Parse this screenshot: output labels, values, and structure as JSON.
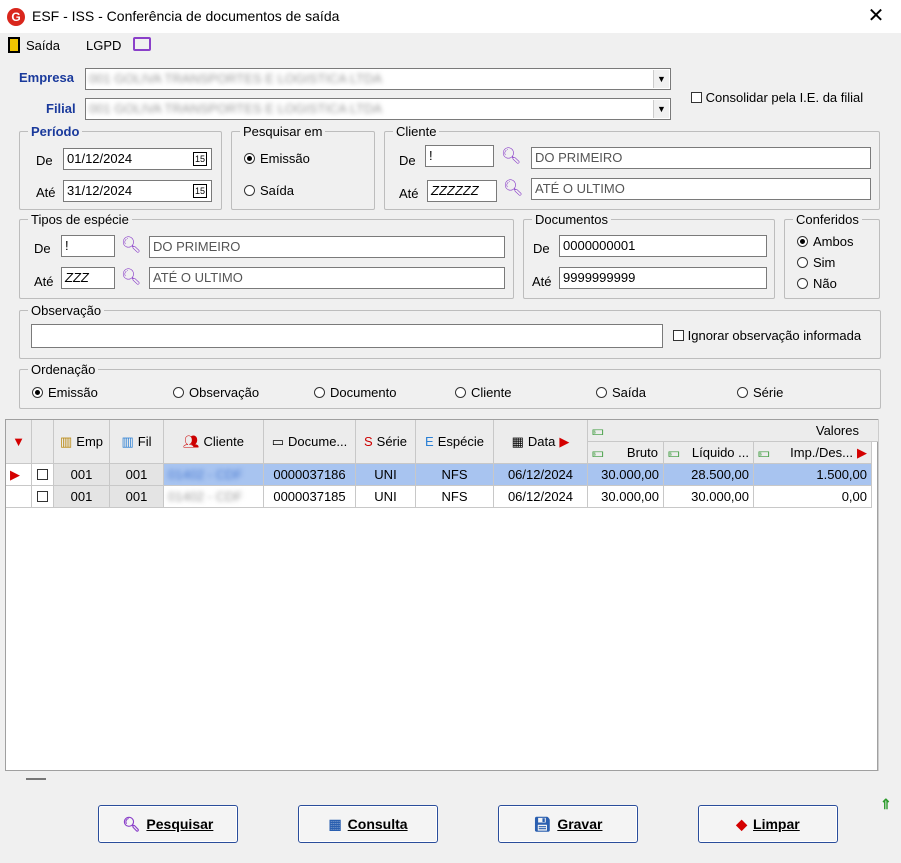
{
  "window": {
    "title": "ESF - ISS - Conferência de documentos de saída",
    "close_glyph": "✕",
    "logo_glyph": "G"
  },
  "menu": {
    "exit_label": "Saída",
    "lgpd_label": "LGPD"
  },
  "empresa": {
    "label": "Empresa",
    "value": "001 GOLIVA TRANSPORTES E LOGISTICA LTDA"
  },
  "filial": {
    "label": "Filial",
    "value": "001 GOLIVA TRANSPORTES E LOGISTICA LTDA"
  },
  "consolidar_label": "Consolidar pela I.E. da filial",
  "periodo": {
    "legend": "Período",
    "de_label": "De",
    "de_value": "01/12/2024",
    "ate_label": "Até",
    "ate_value": "31/12/2024"
  },
  "pesquisar": {
    "legend": "Pesquisar em",
    "opt1": "Emissão",
    "opt2": "Saída"
  },
  "cliente": {
    "legend": "Cliente",
    "de_label": "De",
    "de_code": "!",
    "de_name": "DO PRIMEIRO",
    "ate_label": "Até",
    "ate_code": "ZZZZZZ",
    "ate_name": "ATÉ O ULTIMO"
  },
  "especie": {
    "legend": "Tipos de espécie",
    "de_label": "De",
    "de_code": "!",
    "de_name": "DO PRIMEIRO",
    "ate_label": "Até",
    "ate_code": "ZZZ",
    "ate_name": "ATÉ O ULTIMO"
  },
  "documentos": {
    "legend": "Documentos",
    "de_label": "De",
    "de_value": "0000000001",
    "ate_label": "Até",
    "ate_value": "9999999999"
  },
  "conferidos": {
    "legend": "Conferidos",
    "opt1": "Ambos",
    "opt2": "Sim",
    "opt3": "Não"
  },
  "observacao": {
    "legend": "Observação",
    "value": "",
    "ignore_label": "Ignorar observação informada"
  },
  "ordenacao": {
    "legend": "Ordenação",
    "opts": [
      "Emissão",
      "Observação",
      "Documento",
      "Cliente",
      "Saída",
      "Série"
    ]
  },
  "grid": {
    "headers": {
      "emp": "Emp",
      "fil": "Fil",
      "cliente": "Cliente",
      "documento": "Docume...",
      "serie": "Série",
      "especie": "Espécie",
      "data": "Data",
      "valores": "Valores",
      "bruto": "Bruto",
      "liquido": "Líquido ...",
      "imp": "Imp./Des..."
    },
    "rows": [
      {
        "emp": "001",
        "fil": "001",
        "cliente": "01402 - CDF",
        "documento": "0000037186",
        "serie": "UNI",
        "especie": "NFS",
        "data": "06/12/2024",
        "bruto": "30.000,00",
        "liquido": "28.500,00",
        "imp": "1.500,00"
      },
      {
        "emp": "001",
        "fil": "001",
        "cliente": "01402 - CDF",
        "documento": "0000037185",
        "serie": "UNI",
        "especie": "NFS",
        "data": "06/12/2024",
        "bruto": "30.000,00",
        "liquido": "30.000,00",
        "imp": "0,00"
      }
    ]
  },
  "buttons": {
    "pesquisar": "Pesquisar",
    "consulta": "Consulta",
    "gravar": "Gravar",
    "limpar": "Limpar"
  },
  "colors": {
    "accent": "#1a3a9c",
    "selected_row": "#a8c4f0",
    "logo_red": "#d9261c"
  }
}
